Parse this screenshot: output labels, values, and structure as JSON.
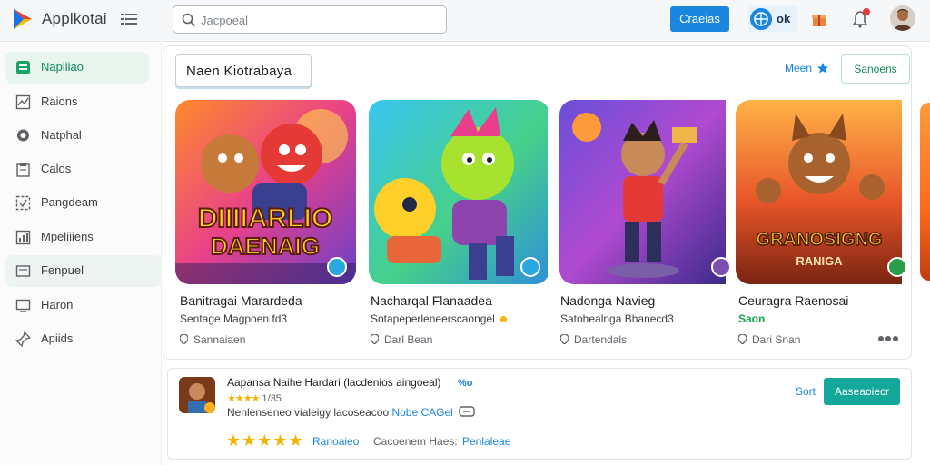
{
  "header": {
    "app_title": "Applkotai",
    "search_placeholder": "Jacpoeal",
    "primary_button": "Craeias",
    "globe_label": "ok"
  },
  "sidebar": {
    "items": [
      {
        "label": "Napliiao",
        "icon": "grid-icon"
      },
      {
        "label": "Raions",
        "icon": "chart-icon"
      },
      {
        "label": "Natphal",
        "icon": "chat-icon"
      },
      {
        "label": "Calos",
        "icon": "clipboard-icon"
      },
      {
        "label": "Pangdeam",
        "icon": "expand-icon"
      },
      {
        "label": "Mpeliiiens",
        "icon": "list-chart-icon"
      },
      {
        "label": "Fenpuel",
        "icon": "folder-icon"
      },
      {
        "label": "Haron",
        "icon": "monitor-icon"
      },
      {
        "label": "Apiids",
        "icon": "pin-icon"
      }
    ]
  },
  "featured": {
    "section_title": "Naen Kiotrabaya",
    "more_label": "Meen",
    "outline_button": "Sanoens",
    "cards": [
      {
        "art_title_1": "DIIIIARLIO",
        "art_title_2": "DAENAIG",
        "title": "Banitragai Marardeda",
        "subtitle": "Sentage Magpoen fd3",
        "meta": "Sannaiaen",
        "accent": "#2aa7e0"
      },
      {
        "art_title_1": "",
        "art_title_2": "",
        "title": "Nacharqal Flanaadea",
        "subtitle": "Sotapeperleneerscaongel",
        "meta": "Darl Bean",
        "accent": "#2aa7e0"
      },
      {
        "art_title_1": "",
        "art_title_2": "",
        "title": "Nadonga Navieg",
        "subtitle": "Satohealnga Bhanecd3",
        "meta": "Dartendals",
        "accent": "#7b4fb0"
      },
      {
        "art_title_1": "GRANOSIGNG",
        "art_title_2": "RANIGA",
        "title": "Ceuragra Raenosai",
        "subtitle": "Saon",
        "meta": "Dari Snan",
        "accent": "#2a9d4a"
      }
    ]
  },
  "list": {
    "title": "Aapansa Naihe Hardari (lacdenios aingoeal)",
    "flag": "%o",
    "rating_value": "1/35",
    "description": "Nenlenseneo vialeigy lacoseacoo",
    "tag": "Nobe CAGel",
    "link1": "Ranoaieo",
    "link2": "Cacoenem Haes:",
    "link3": "Penlaleae",
    "sort_label": "Sort",
    "action_button": "Aaseaoiecr"
  }
}
